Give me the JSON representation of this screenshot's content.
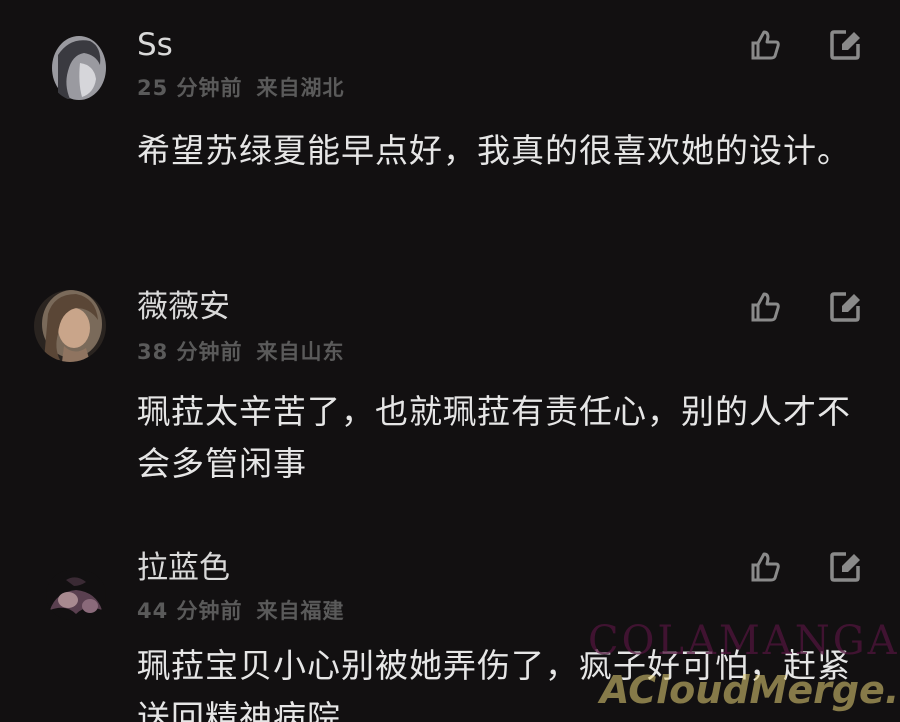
{
  "comments": [
    {
      "username": "Ss",
      "time": "25 分钟前",
      "from": "来自湖北",
      "text": "希望苏绿夏能早点好，我真的很喜欢她的设计。",
      "like_icon": "thumbs-up-icon",
      "reply_icon": "reply-icon"
    },
    {
      "username": "薇薇安",
      "time": "38 分钟前",
      "from": "来自山东",
      "text": "珮菈太辛苦了，也就珮菈有责任心，别的人才不会多管闲事",
      "like_icon": "thumbs-up-icon",
      "reply_icon": "reply-icon"
    },
    {
      "username": "拉蓝色",
      "time": "44 分钟前",
      "from": "来自福建",
      "text": "珮菈宝贝小心别被她弄伤了，疯子好可怕，赶紧送回精神病院",
      "like_icon": "thumbs-up-icon",
      "reply_icon": "reply-icon"
    }
  ],
  "watermark": {
    "line1": "COLAMANGA.com",
    "line2": "ACloudMerge.com"
  },
  "colors": {
    "background": "#121011",
    "username": "#d9d9d9",
    "meta": "#5a5a5a",
    "body": "#e6e6e6",
    "icon": "#8a8a8a"
  }
}
